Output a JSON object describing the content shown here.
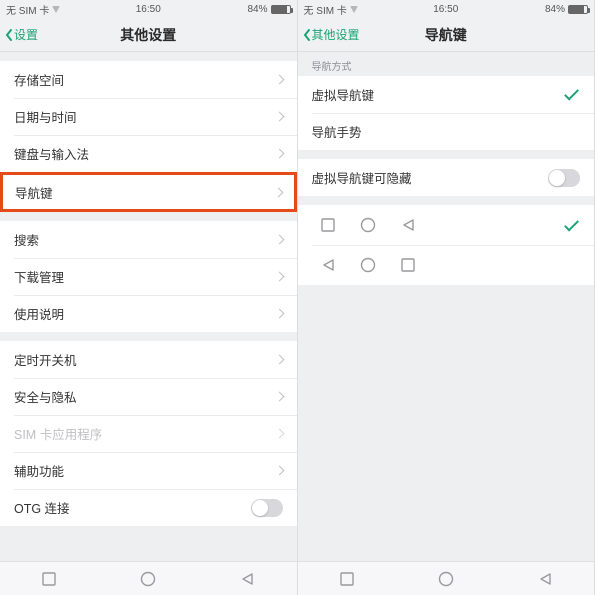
{
  "status": {
    "carrier": "无 SIM 卡",
    "time": "16:50",
    "battery_pct": "84%"
  },
  "left": {
    "back_label": "设置",
    "title": "其他设置",
    "group1": [
      "存储空间",
      "日期与时间",
      "键盘与输入法"
    ],
    "highlighted": "导航键",
    "group2": [
      "搜索",
      "下载管理",
      "使用说明"
    ],
    "group3": [
      {
        "label": "定时开关机",
        "type": "chevron"
      },
      {
        "label": "安全与隐私",
        "type": "chevron"
      },
      {
        "label": "SIM 卡应用程序",
        "type": "chevron",
        "disabled": true
      },
      {
        "label": "辅助功能",
        "type": "chevron"
      },
      {
        "label": "OTG 连接",
        "type": "toggle"
      }
    ]
  },
  "right": {
    "back_label": "其他设置",
    "title": "导航键",
    "section_label": "导航方式",
    "mode_rows": [
      {
        "label": "虚拟导航键",
        "selected": true
      },
      {
        "label": "导航手势",
        "selected": false
      }
    ],
    "hide_row": {
      "label": "虚拟导航键可隐藏"
    },
    "layouts": [
      {
        "order": [
          "square",
          "circle",
          "triangle"
        ],
        "selected": true
      },
      {
        "order": [
          "triangle",
          "circle",
          "square"
        ],
        "selected": false
      }
    ]
  }
}
